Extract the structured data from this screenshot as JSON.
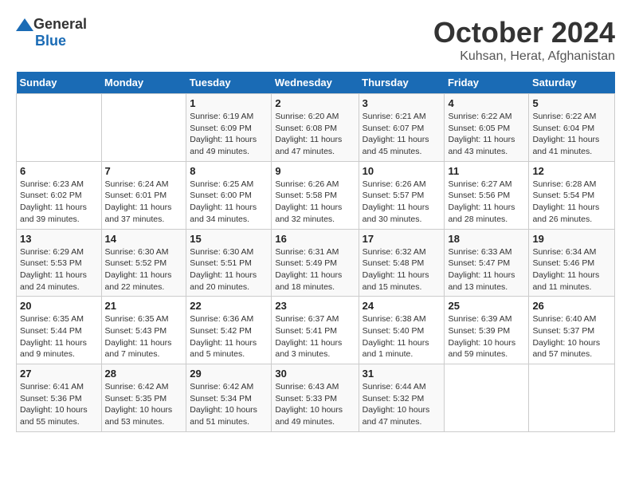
{
  "header": {
    "logo_general": "General",
    "logo_blue": "Blue",
    "title": "October 2024",
    "subtitle": "Kuhsan, Herat, Afghanistan"
  },
  "days_of_week": [
    "Sunday",
    "Monday",
    "Tuesday",
    "Wednesday",
    "Thursday",
    "Friday",
    "Saturday"
  ],
  "weeks": [
    [
      {
        "day": "",
        "info": ""
      },
      {
        "day": "",
        "info": ""
      },
      {
        "day": "1",
        "info": "Sunrise: 6:19 AM\nSunset: 6:09 PM\nDaylight: 11 hours and 49 minutes."
      },
      {
        "day": "2",
        "info": "Sunrise: 6:20 AM\nSunset: 6:08 PM\nDaylight: 11 hours and 47 minutes."
      },
      {
        "day": "3",
        "info": "Sunrise: 6:21 AM\nSunset: 6:07 PM\nDaylight: 11 hours and 45 minutes."
      },
      {
        "day": "4",
        "info": "Sunrise: 6:22 AM\nSunset: 6:05 PM\nDaylight: 11 hours and 43 minutes."
      },
      {
        "day": "5",
        "info": "Sunrise: 6:22 AM\nSunset: 6:04 PM\nDaylight: 11 hours and 41 minutes."
      }
    ],
    [
      {
        "day": "6",
        "info": "Sunrise: 6:23 AM\nSunset: 6:02 PM\nDaylight: 11 hours and 39 minutes."
      },
      {
        "day": "7",
        "info": "Sunrise: 6:24 AM\nSunset: 6:01 PM\nDaylight: 11 hours and 37 minutes."
      },
      {
        "day": "8",
        "info": "Sunrise: 6:25 AM\nSunset: 6:00 PM\nDaylight: 11 hours and 34 minutes."
      },
      {
        "day": "9",
        "info": "Sunrise: 6:26 AM\nSunset: 5:58 PM\nDaylight: 11 hours and 32 minutes."
      },
      {
        "day": "10",
        "info": "Sunrise: 6:26 AM\nSunset: 5:57 PM\nDaylight: 11 hours and 30 minutes."
      },
      {
        "day": "11",
        "info": "Sunrise: 6:27 AM\nSunset: 5:56 PM\nDaylight: 11 hours and 28 minutes."
      },
      {
        "day": "12",
        "info": "Sunrise: 6:28 AM\nSunset: 5:54 PM\nDaylight: 11 hours and 26 minutes."
      }
    ],
    [
      {
        "day": "13",
        "info": "Sunrise: 6:29 AM\nSunset: 5:53 PM\nDaylight: 11 hours and 24 minutes."
      },
      {
        "day": "14",
        "info": "Sunrise: 6:30 AM\nSunset: 5:52 PM\nDaylight: 11 hours and 22 minutes."
      },
      {
        "day": "15",
        "info": "Sunrise: 6:30 AM\nSunset: 5:51 PM\nDaylight: 11 hours and 20 minutes."
      },
      {
        "day": "16",
        "info": "Sunrise: 6:31 AM\nSunset: 5:49 PM\nDaylight: 11 hours and 18 minutes."
      },
      {
        "day": "17",
        "info": "Sunrise: 6:32 AM\nSunset: 5:48 PM\nDaylight: 11 hours and 15 minutes."
      },
      {
        "day": "18",
        "info": "Sunrise: 6:33 AM\nSunset: 5:47 PM\nDaylight: 11 hours and 13 minutes."
      },
      {
        "day": "19",
        "info": "Sunrise: 6:34 AM\nSunset: 5:46 PM\nDaylight: 11 hours and 11 minutes."
      }
    ],
    [
      {
        "day": "20",
        "info": "Sunrise: 6:35 AM\nSunset: 5:44 PM\nDaylight: 11 hours and 9 minutes."
      },
      {
        "day": "21",
        "info": "Sunrise: 6:35 AM\nSunset: 5:43 PM\nDaylight: 11 hours and 7 minutes."
      },
      {
        "day": "22",
        "info": "Sunrise: 6:36 AM\nSunset: 5:42 PM\nDaylight: 11 hours and 5 minutes."
      },
      {
        "day": "23",
        "info": "Sunrise: 6:37 AM\nSunset: 5:41 PM\nDaylight: 11 hours and 3 minutes."
      },
      {
        "day": "24",
        "info": "Sunrise: 6:38 AM\nSunset: 5:40 PM\nDaylight: 11 hours and 1 minute."
      },
      {
        "day": "25",
        "info": "Sunrise: 6:39 AM\nSunset: 5:39 PM\nDaylight: 10 hours and 59 minutes."
      },
      {
        "day": "26",
        "info": "Sunrise: 6:40 AM\nSunset: 5:37 PM\nDaylight: 10 hours and 57 minutes."
      }
    ],
    [
      {
        "day": "27",
        "info": "Sunrise: 6:41 AM\nSunset: 5:36 PM\nDaylight: 10 hours and 55 minutes."
      },
      {
        "day": "28",
        "info": "Sunrise: 6:42 AM\nSunset: 5:35 PM\nDaylight: 10 hours and 53 minutes."
      },
      {
        "day": "29",
        "info": "Sunrise: 6:42 AM\nSunset: 5:34 PM\nDaylight: 10 hours and 51 minutes."
      },
      {
        "day": "30",
        "info": "Sunrise: 6:43 AM\nSunset: 5:33 PM\nDaylight: 10 hours and 49 minutes."
      },
      {
        "day": "31",
        "info": "Sunrise: 6:44 AM\nSunset: 5:32 PM\nDaylight: 10 hours and 47 minutes."
      },
      {
        "day": "",
        "info": ""
      },
      {
        "day": "",
        "info": ""
      }
    ]
  ]
}
